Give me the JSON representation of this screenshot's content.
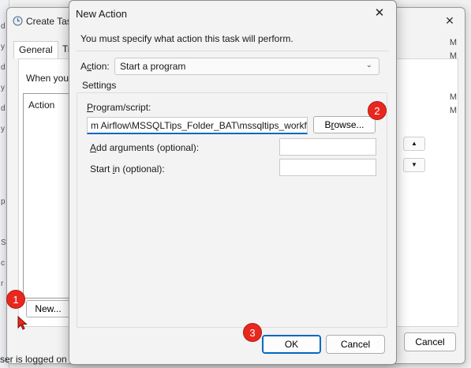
{
  "background_strip": {
    "chars": [
      "d",
      "y",
      "d",
      "y",
      "d",
      "y",
      "p",
      "S",
      "c",
      "r"
    ]
  },
  "create_task": {
    "title": "Create Task",
    "tabs": [
      "General",
      "Triggers"
    ],
    "when_text": "When you c",
    "action_header": "Action",
    "new_button": "New...",
    "cancel_button": "Cancel",
    "bottom_text": "ser is logged on",
    "right_edge_labels": [
      "M",
      "M",
      "M",
      "M"
    ],
    "up_arrow": "▲",
    "down_arrow": "▼"
  },
  "new_action": {
    "title": "New Action",
    "instruction": "You must specify what action this task will perform.",
    "action_label_prefix": "A",
    "action_label_accel": "c",
    "action_label_suffix": "tion:",
    "action_value": "Start a program",
    "settings_label": "Settings",
    "program_label_accel": "P",
    "program_label_rest": "rogram/script:",
    "program_value": "m Airflow\\MSSQLTips_Folder_BAT\\mssqltips_workflow.bat\"",
    "browse_prefix": "B",
    "browse_accel": "r",
    "browse_suffix": "owse...",
    "args_label_accel": "A",
    "args_label_rest": "dd arguments (optional):",
    "start_label_prefix": "Start ",
    "start_label_accel": "i",
    "start_label_suffix": "n (optional):",
    "ok_button": "OK",
    "cancel_button": "Cancel"
  },
  "callouts": [
    "1",
    "2",
    "3"
  ],
  "icons": {
    "task_icon": "clock-icon",
    "close": "close-icon",
    "dropdown": "chevron-down-icon",
    "cursor": "mouse-pointer-icon"
  },
  "colors": {
    "accent": "#0067c0",
    "callout": "#e8281e"
  }
}
